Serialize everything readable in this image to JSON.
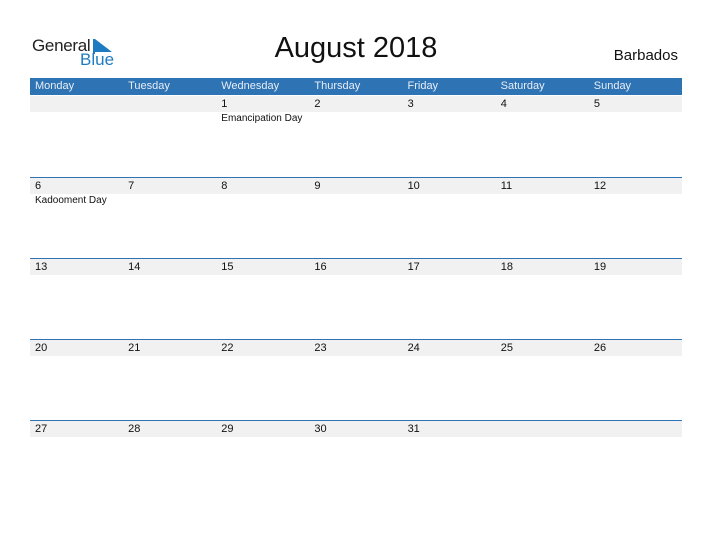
{
  "logo": {
    "text_top": "General",
    "text_bottom": "Blue"
  },
  "title": "August 2018",
  "country": "Barbados",
  "weekdays": [
    "Monday",
    "Tuesday",
    "Wednesday",
    "Thursday",
    "Friday",
    "Saturday",
    "Sunday"
  ],
  "weeks": [
    [
      {
        "day": ""
      },
      {
        "day": ""
      },
      {
        "day": "1",
        "event": "Emancipation Day"
      },
      {
        "day": "2"
      },
      {
        "day": "3"
      },
      {
        "day": "4"
      },
      {
        "day": "5"
      }
    ],
    [
      {
        "day": "6",
        "event": "Kadooment Day"
      },
      {
        "day": "7"
      },
      {
        "day": "8"
      },
      {
        "day": "9"
      },
      {
        "day": "10"
      },
      {
        "day": "11"
      },
      {
        "day": "12"
      }
    ],
    [
      {
        "day": "13"
      },
      {
        "day": "14"
      },
      {
        "day": "15"
      },
      {
        "day": "16"
      },
      {
        "day": "17"
      },
      {
        "day": "18"
      },
      {
        "day": "19"
      }
    ],
    [
      {
        "day": "20"
      },
      {
        "day": "21"
      },
      {
        "day": "22"
      },
      {
        "day": "23"
      },
      {
        "day": "24"
      },
      {
        "day": "25"
      },
      {
        "day": "26"
      }
    ],
    [
      {
        "day": "27"
      },
      {
        "day": "28"
      },
      {
        "day": "29"
      },
      {
        "day": "30"
      },
      {
        "day": "31"
      },
      {
        "day": ""
      },
      {
        "day": ""
      }
    ]
  ],
  "colors": {
    "accent": "#2e73b4",
    "logo_blue": "#1f7bc1",
    "date_strip": "#f1f1f1"
  }
}
